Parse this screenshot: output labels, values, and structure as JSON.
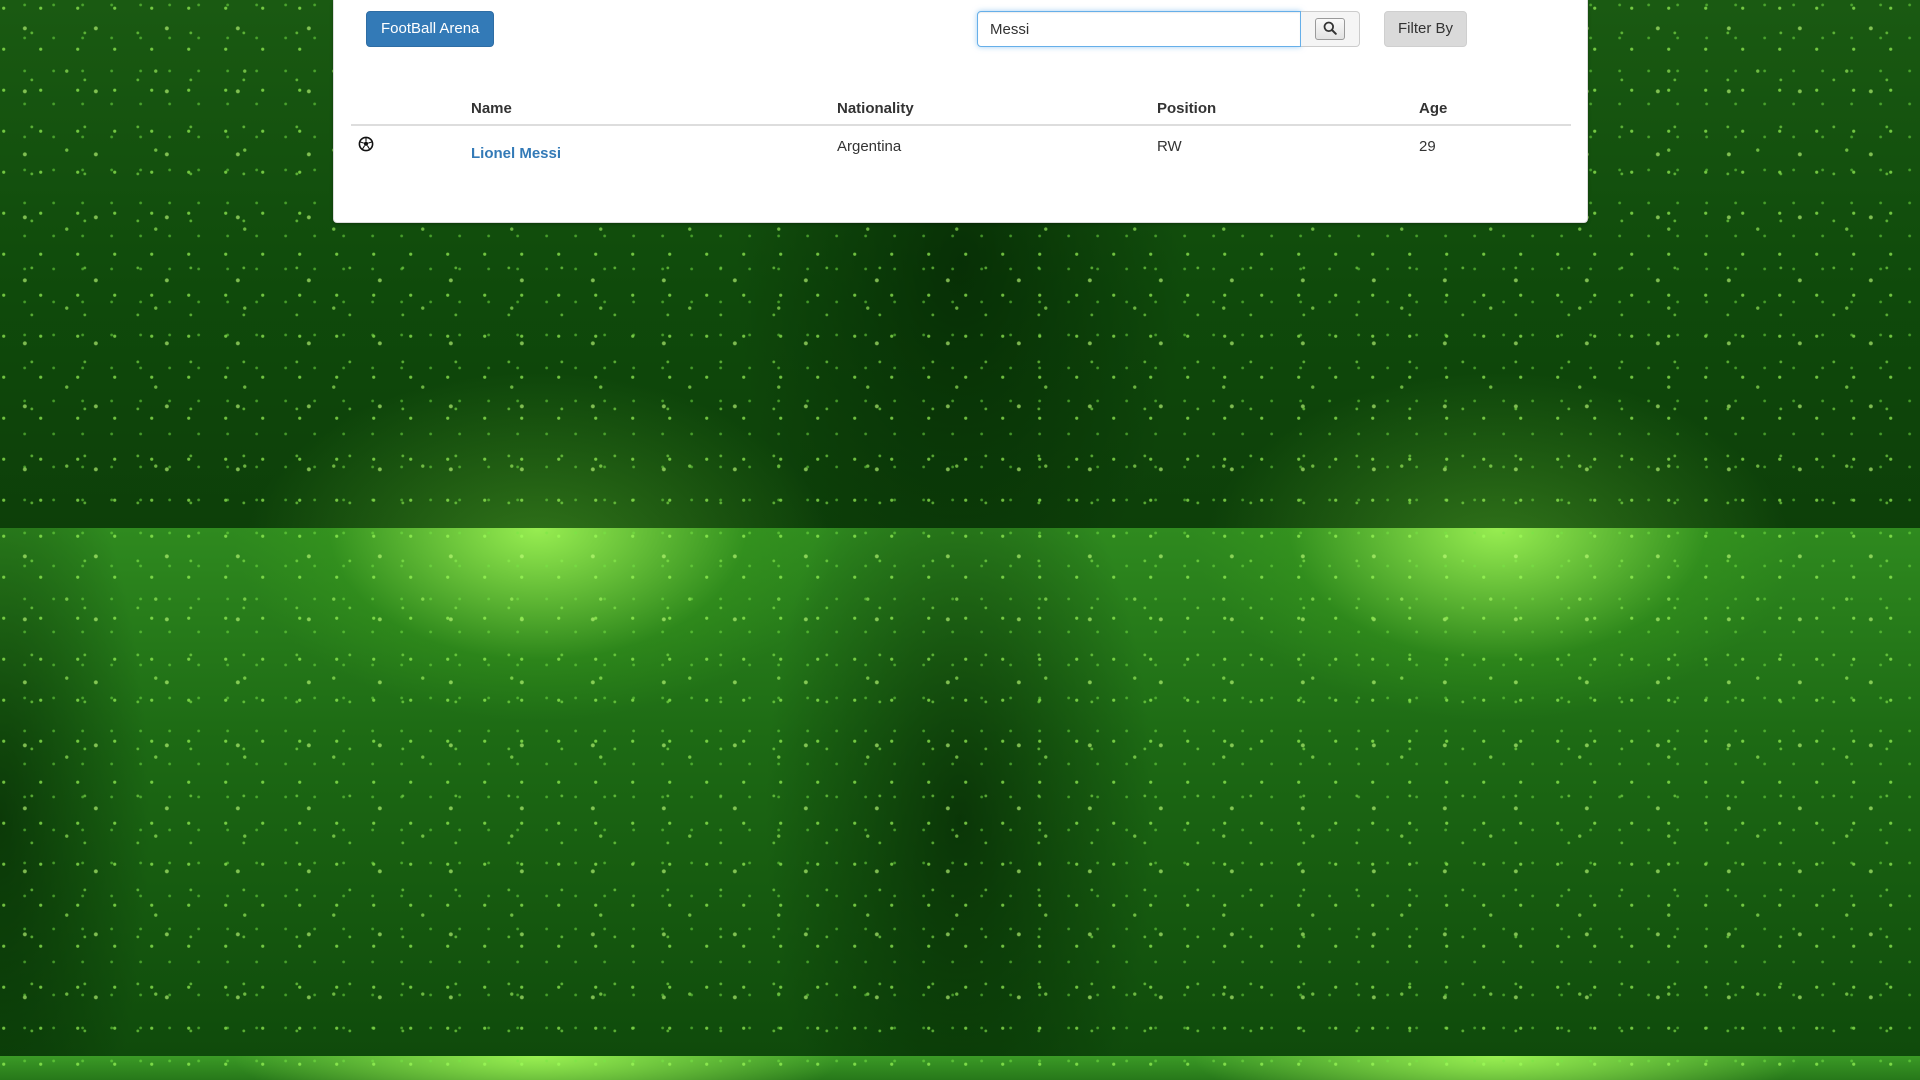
{
  "header": {
    "brand_label": "FootBall Arena",
    "search_value": "Messi",
    "filter_label": "Filter By"
  },
  "icons": {
    "search": "search-icon",
    "ball": "soccer-ball-icon"
  },
  "table": {
    "columns": [
      "",
      "Name",
      "Nationality",
      "Position",
      "Age"
    ],
    "rows": [
      {
        "name": "Lionel Messi",
        "nationality": "Argentina",
        "position": "RW",
        "age": "29"
      }
    ]
  },
  "colors": {
    "brand_button": "#337ab7",
    "link": "#337ab7",
    "background": "#1d6a14"
  }
}
